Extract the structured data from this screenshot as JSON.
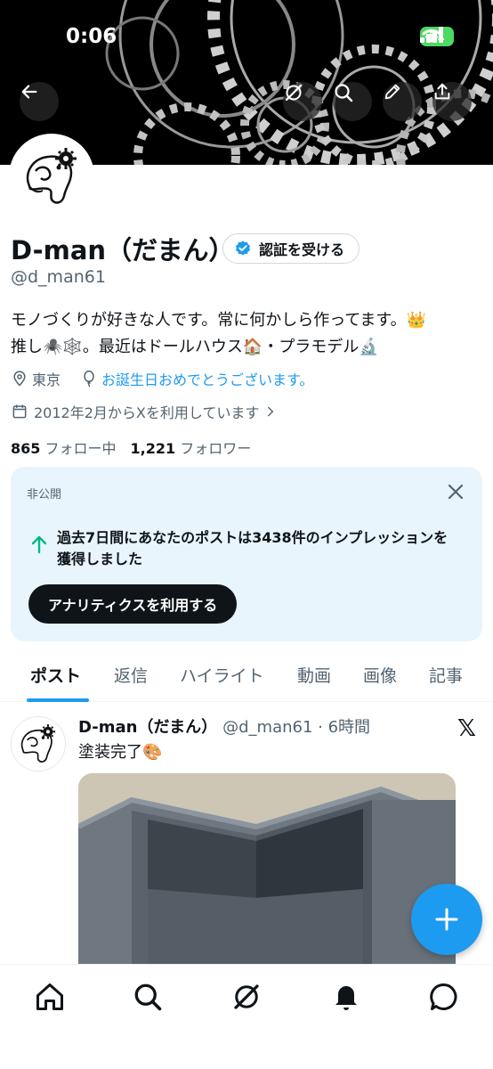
{
  "status_bar": {
    "time": "0:06",
    "battery": "21"
  },
  "profile": {
    "name": "D-man（だまん）",
    "verify_label": "認証を受ける",
    "handle": "@d_man61",
    "bio_line1": "モノづくりが好きな人です。常に何かしら作ってます。👑",
    "bio_line2": "推し🕷️🕸️。最近はドールハウス🏠・プラモデル🔬",
    "location": "東京",
    "birthday_text": "お誕生日おめでとうございます。",
    "joined": "2012年2月からXを利用しています",
    "following_count": "865",
    "following_label": "フォロー中",
    "followers_count": "1,221",
    "followers_label": "フォロワー"
  },
  "private_card": {
    "tag": "非公開",
    "text": "過去7日間にあなたのポストは3438件のインプレッションを獲得しました",
    "button_label": "アナリティクスを利用する"
  },
  "tabs": [
    {
      "label": "ポスト"
    },
    {
      "label": "返信"
    },
    {
      "label": "ハイライト"
    },
    {
      "label": "動画"
    },
    {
      "label": "画像"
    },
    {
      "label": "記事"
    }
  ],
  "post": {
    "name": "D-man（だまん）",
    "meta": "@d_man61 · 6時間",
    "x_logo": "𝕏",
    "text": "塗装完了🎨"
  },
  "icons": {
    "back": "arrow-left-icon",
    "grok": "grok-icon",
    "search": "search-icon",
    "edit": "pencil-icon",
    "share": "share-icon"
  },
  "colors": {
    "accent": "#1d9bf0",
    "text": "#0f1419",
    "muted": "#536471",
    "card_bg": "#e8f5fd"
  }
}
